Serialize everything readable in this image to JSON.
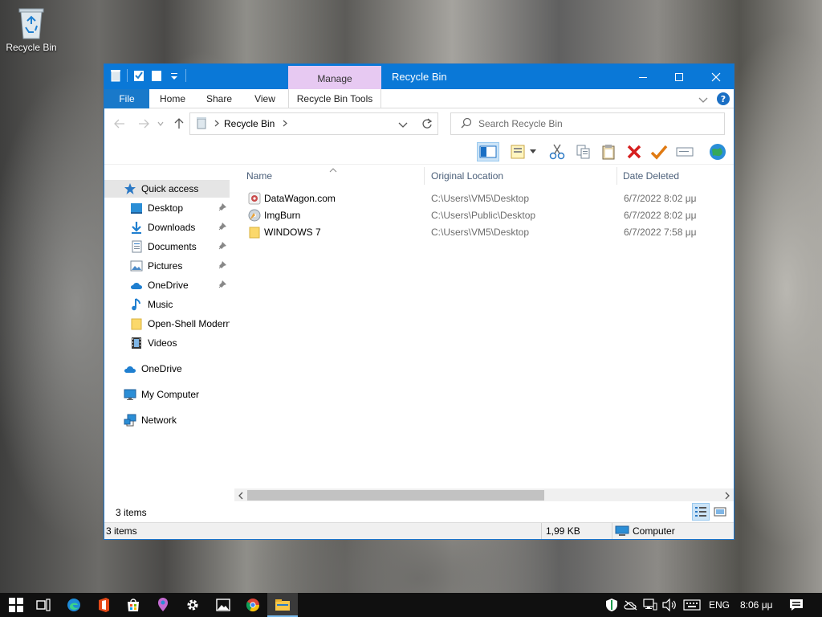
{
  "desktop": {
    "icon_label": "Recycle Bin"
  },
  "window": {
    "title": "Recycle Bin",
    "manage_tab": "Manage",
    "ribbon_tabs": [
      "File",
      "Home",
      "Share",
      "View",
      "Recycle Bin Tools"
    ]
  },
  "address": {
    "breadcrumb": "Recycle Bin",
    "search_placeholder": "Search Recycle Bin"
  },
  "nav": {
    "quick_access": "Quick access",
    "items": [
      "Desktop",
      "Downloads",
      "Documents",
      "Pictures",
      "OneDrive",
      "Music",
      "Open-Shell Modern",
      "Videos"
    ],
    "onedrive": "OneDrive",
    "my_computer": "My Computer",
    "network": "Network"
  },
  "columns": {
    "name": "Name",
    "original_location": "Original Location",
    "date_deleted": "Date Deleted"
  },
  "files": [
    {
      "name": "DataWagon.com",
      "location": "C:\\Users\\VM5\\Desktop",
      "date": "6/7/2022 8:02 μμ",
      "icon": "app-icon"
    },
    {
      "name": "ImgBurn",
      "location": "C:\\Users\\Public\\Desktop",
      "date": "6/7/2022 8:02 μμ",
      "icon": "imgburn-icon"
    },
    {
      "name": "WINDOWS 7",
      "location": "C:\\Users\\VM5\\Desktop",
      "date": "6/7/2022 7:58 μμ",
      "icon": "folder-icon"
    }
  ],
  "status": {
    "items_top": "3 items",
    "items_bottom": "3 items",
    "size": "1,99 KB",
    "computer": "Computer"
  },
  "taskbar": {
    "language": "ENG",
    "time": "8:06 μμ"
  },
  "colors": {
    "titlebar": "#0a78d7",
    "manage_tab": "#e7c9f2",
    "file_tab": "#1979ca",
    "selection": "#cce4f7"
  }
}
